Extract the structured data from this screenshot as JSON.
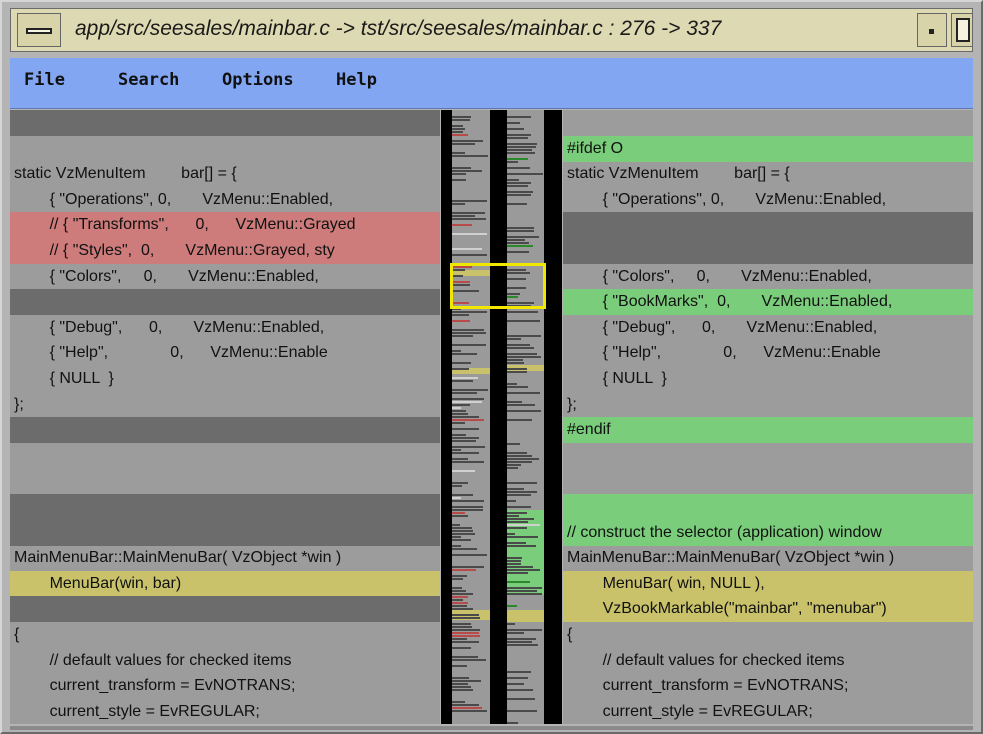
{
  "window": {
    "title": "app/src/seesales/mainbar.c -> tst/src/seesales/mainbar.c : 276 -> 337"
  },
  "menu": {
    "items": [
      "File",
      "Search",
      "Options",
      "Help"
    ]
  },
  "colors": {
    "menubar": "#82a6f2",
    "deleted": "#cd7b7b",
    "inserted": "#7acd7a",
    "changed": "#c9c26a",
    "missing": "#6c6c6c",
    "viewport": "#f0e800"
  },
  "left_pane": {
    "lines": [
      {
        "text": "",
        "hl": "gray"
      },
      {
        "text": "",
        "hl": "none"
      },
      {
        "text": "static VzMenuItem        bar[] = {",
        "hl": "none"
      },
      {
        "text": "        { \"Operations\", 0,       VzMenu::Enabled,",
        "hl": "none"
      },
      {
        "text": "        // { \"Transforms\",      0,      VzMenu::Grayed",
        "hl": "red"
      },
      {
        "text": "        // { \"Styles\",  0,       VzMenu::Grayed, sty",
        "hl": "red"
      },
      {
        "text": "        { \"Colors\",     0,       VzMenu::Enabled,",
        "hl": "none"
      },
      {
        "text": "",
        "hl": "gray"
      },
      {
        "text": "        { \"Debug\",      0,       VzMenu::Enabled,",
        "hl": "none"
      },
      {
        "text": "        { \"Help\",              0,      VzMenu::Enable",
        "hl": "none"
      },
      {
        "text": "        { NULL  }",
        "hl": "none"
      },
      {
        "text": "};",
        "hl": "none"
      },
      {
        "text": "",
        "hl": "gray"
      },
      {
        "text": "",
        "hl": "none"
      },
      {
        "text": "",
        "hl": "none"
      },
      {
        "text": "",
        "hl": "gray"
      },
      {
        "text": "",
        "hl": "gray"
      },
      {
        "text": "MainMenuBar::MainMenuBar( VzObject *win )",
        "hl": "none"
      },
      {
        "text": "        MenuBar(win, bar)",
        "hl": "yellow"
      },
      {
        "text": "",
        "hl": "gray"
      },
      {
        "text": "{",
        "hl": "none"
      },
      {
        "text": "        // default values for checked items",
        "hl": "none"
      },
      {
        "text": "        current_transform = EvNOTRANS;",
        "hl": "none"
      },
      {
        "text": "        current_style = EvREGULAR;",
        "hl": "none"
      }
    ]
  },
  "right_pane": {
    "lines": [
      {
        "text": "",
        "hl": "none"
      },
      {
        "text": "#ifdef O",
        "hl": "green"
      },
      {
        "text": "static VzMenuItem        bar[] = {",
        "hl": "none"
      },
      {
        "text": "        { \"Operations\", 0,       VzMenu::Enabled,",
        "hl": "none"
      },
      {
        "text": "",
        "hl": "gray"
      },
      {
        "text": "",
        "hl": "gray"
      },
      {
        "text": "        { \"Colors\",     0,       VzMenu::Enabled,",
        "hl": "none"
      },
      {
        "text": "        { \"BookMarks\",  0,       VzMenu::Enabled,",
        "hl": "green"
      },
      {
        "text": "        { \"Debug\",      0,       VzMenu::Enabled,",
        "hl": "none"
      },
      {
        "text": "        { \"Help\",              0,      VzMenu::Enable",
        "hl": "none"
      },
      {
        "text": "        { NULL  }",
        "hl": "none"
      },
      {
        "text": "};",
        "hl": "none"
      },
      {
        "text": "#endif",
        "hl": "green"
      },
      {
        "text": "",
        "hl": "none"
      },
      {
        "text": "",
        "hl": "none"
      },
      {
        "text": "",
        "hl": "green"
      },
      {
        "text": "// construct the selector (application) window ",
        "hl": "green"
      },
      {
        "text": "MainMenuBar::MainMenuBar( VzObject *win )",
        "hl": "none"
      },
      {
        "text": "        MenuBar( win, NULL ),",
        "hl": "yellow"
      },
      {
        "text": "        VzBookMarkable(\"mainbar\", \"menubar\")",
        "hl": "yellow"
      },
      {
        "text": "{",
        "hl": "none"
      },
      {
        "text": "        // default values for checked items",
        "hl": "none"
      },
      {
        "text": "        current_transform = EvNOTRANS;",
        "hl": "none"
      },
      {
        "text": "        current_style = EvREGULAR;",
        "hl": "none"
      }
    ]
  }
}
